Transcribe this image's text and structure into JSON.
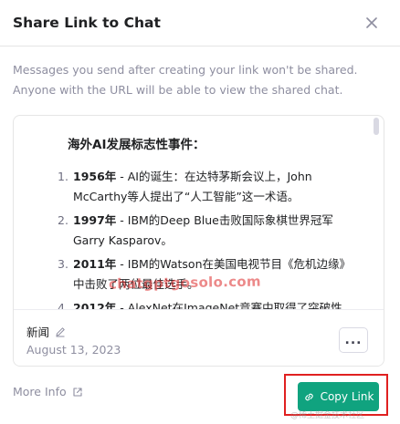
{
  "dialog": {
    "title": "Share Link to Chat",
    "description": "Messages you send after creating your link won't be shared. Anyone with the URL will be able to view the shared chat."
  },
  "preview": {
    "heading": "海外AI发展标志性事件：",
    "events": [
      {
        "num": "1.",
        "year": "1956年",
        "text": " - AI的诞生：在达特茅斯会议上，John McCarthy等人提出了“人工智能”这一术语。"
      },
      {
        "num": "2.",
        "year": "1997年",
        "text": " - IBM的Deep Blue击败国际象棋世界冠军Garry Kasparov。"
      },
      {
        "num": "3.",
        "year": "2011年",
        "text": " - IBM的Watson在美国电视节目《危机边缘》中击败了两位最佳选手。"
      },
      {
        "num": "4.",
        "year": "2012年",
        "text": " - AlexNet在ImageNet竞赛中取得了突破性"
      }
    ],
    "watermark": "chatgptgosolo.com"
  },
  "chat_footer": {
    "name": "新闻",
    "date": "August 13, 2023",
    "more_label": "..."
  },
  "bottom": {
    "more_info": "More Info",
    "copy_link": "Copy Link",
    "corner_watermark": "@稀土掘金技术社区"
  },
  "colors": {
    "accent": "#10a37f",
    "highlight_border": "#e02020",
    "muted_text": "#8e8ea0"
  },
  "icons": {
    "close": "close-icon",
    "edit": "pencil-icon",
    "external": "external-link-icon",
    "link": "link-icon"
  }
}
